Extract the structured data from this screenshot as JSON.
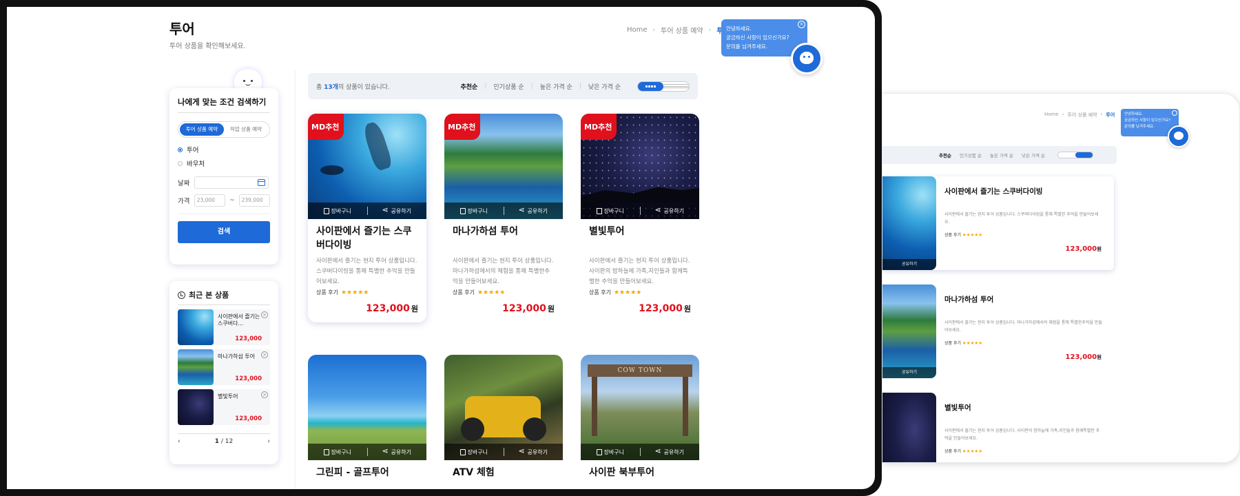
{
  "header": {
    "title": "투어",
    "subtitle": "투어 상품을 확인해보세요.",
    "breadcrumb": [
      "Home",
      "투어 상품 예약",
      "투어"
    ]
  },
  "chat": {
    "lines": [
      "안녕하세요.",
      "궁금하신 사항이 있으신가요?",
      "문의를 남겨주세요."
    ]
  },
  "search_panel": {
    "title": "나에게 맞는 조건 검색하기",
    "tab_active": "투어 상품 예약",
    "tab_inactive": "픽업 상품 예약",
    "radio_tour": "투어",
    "radio_voucher": "바우처",
    "date_label": "날짜",
    "price_label": "가격",
    "price_min": "23,000",
    "price_max": "239,000",
    "tilde": "~",
    "search_button": "검색"
  },
  "recent": {
    "title": "최근 본 상품",
    "items": [
      {
        "name": "사이판에서 즐기는 스쿠버다...",
        "price": "123,000"
      },
      {
        "name": "마나가하섬 투어",
        "price": "123,000"
      },
      {
        "name": "별빛투어",
        "price": "123,000"
      }
    ],
    "page_current": "1",
    "page_total": "12",
    "page_sep": "/",
    "prev": "‹",
    "next": "›"
  },
  "toolbar": {
    "count_prefix": "총",
    "count_value": "13개",
    "count_suffix": "의 상품이 있습니다.",
    "sorts": [
      "추천순",
      "인기상품 순",
      "높은 가격 순",
      "낮은 가격 순"
    ],
    "sort_sep": "|"
  },
  "cards": [
    {
      "badge": "MD추천",
      "title": "사이판에서 즐기는 스쿠버다이빙",
      "desc": "사이판에서 즐기는 현지 투어 상품입니다. 스쿠버다이빙을 통해 특별한 추억을 만들어보세요.",
      "review_label": "상품 후기",
      "stars": "★★★★★",
      "price": "123,000",
      "won": "원"
    },
    {
      "badge": "MD추천",
      "title": "마나가하섬 투어",
      "desc": "사이판에서 즐기는 현지 투어 상품입니다. 마나가하섬에서의 체험을 통해 특별한추억을 만들어보세요.",
      "review_label": "상품 후기",
      "stars": "★★★★★",
      "price": "123,000",
      "won": "원"
    },
    {
      "badge": "MD추천",
      "title": "별빛투어",
      "desc": "사이판에서 즐기는 현지 투어 상품입니다. 사이판의 밤하늘에 가족,지인들과 함께특별한 추억을 만들어보세요.",
      "review_label": "상품 후기",
      "stars": "★★★★★",
      "price": "123,000",
      "won": "원"
    },
    {
      "title": "그린피 - 골프투어"
    },
    {
      "title": "ATV 체험"
    },
    {
      "title": "사이판 북부투어",
      "sign": "COW TOWN"
    }
  ],
  "card_actions": {
    "cart": "장바구니",
    "share": "공유하기"
  },
  "second_view": {
    "breadcrumb": [
      "Home",
      "투어 상품 예약",
      "투어"
    ],
    "chat_lines": [
      "안녕하세요.",
      "궁금하신 사항이 있으신가요?",
      "문의를 남겨주세요."
    ],
    "sorts": [
      "추천순",
      "인기상품 순",
      "높은 가격 순",
      "낮은 가격 순"
    ],
    "rows": [
      {
        "title": "사이판에서 즐기는 스쿠버다이빙",
        "desc": "사이판에서 즐기는 현지 투어 상품입니다. 스쿠버다이빙을 통해 특별한 추억을 만들어보세요.",
        "review": "상품 후기",
        "stars": "★★★★★",
        "price": "123,000",
        "won": "원",
        "share": "공유하기"
      },
      {
        "title": "마나가하섬 투어",
        "desc": "사이판에서 즐기는 현지 투어 상품입니다. 마나가하섬에서의 체험을 통해 특별한추억을 만들어보세요.",
        "review": "상품 후기",
        "stars": "★★★★★",
        "price": "123,000",
        "won": "원",
        "share": "공유하기"
      },
      {
        "title": "별빛투어",
        "desc": "사이판에서 즐기는 현지 투어 상품입니다. 사이판의 밤하늘에 가족,지인들과 함께특별한 추억을 만들어보세요.",
        "review": "상품 후기",
        "stars": "★★★★★"
      }
    ]
  }
}
